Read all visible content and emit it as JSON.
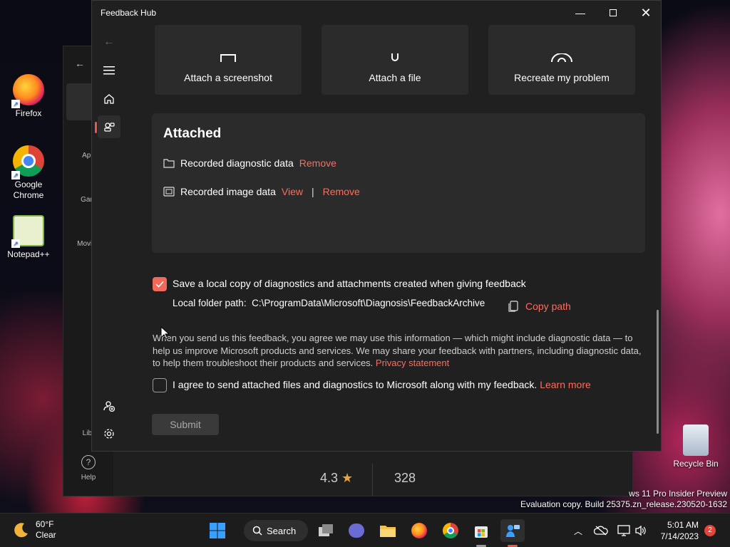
{
  "desktop": {
    "icons": [
      {
        "label": "Firefox"
      },
      {
        "label": "Google Chrome"
      },
      {
        "label": "Notepad++"
      },
      {
        "label": "Recycle Bin"
      }
    ],
    "watermark_line1": "ws 11 Pro Insider Preview",
    "watermark_line2": "Evaluation copy. Build 25375.zn_release.230520-1632"
  },
  "store_window": {
    "side_items": [
      "App",
      "Gam",
      "Movies",
      "Libr",
      "Help"
    ],
    "rating": "4.3",
    "rating_count": "328"
  },
  "feedback_hub": {
    "title": "Feedback Hub",
    "attach_buttons": [
      "Attach a screenshot",
      "Attach a file",
      "Recreate my problem"
    ],
    "attached_heading": "Attached",
    "attachments": [
      {
        "label": "Recorded diagnostic data",
        "actions": [
          "Remove"
        ]
      },
      {
        "label": "Recorded image data",
        "actions": [
          "View",
          "Remove"
        ]
      }
    ],
    "save_local_copy": {
      "checked": true,
      "label": "Save a local copy of diagnostics and attachments created when giving feedback",
      "path_label": "Local folder path:",
      "path_value": "C:\\ProgramData\\Microsoft\\Diagnosis\\FeedbackArchive",
      "copy_button": "Copy path"
    },
    "disclaimer": "When you send us this feedback, you agree we may use this information — which might include diagnostic data — to help us improve Microsoft products and services. We may share your feedback with partners, including diagnostic data, to help them troubleshoot their products and services.",
    "privacy_link": "Privacy statement",
    "agree": {
      "checked": false,
      "label": "I agree to send attached files and diagnostics to Microsoft along with my feedback.",
      "link": "Learn more"
    },
    "submit_label": "Submit"
  },
  "taskbar": {
    "weather_temp": "60°F",
    "weather_desc": "Clear",
    "search_label": "Search",
    "time": "5:01 AM",
    "date": "7/14/2023",
    "notification_count": "2"
  },
  "colors": {
    "accent": "#ef6a5a",
    "link": "#ff6b5c",
    "window_bg": "#202020",
    "card_bg": "#2b2b2b"
  }
}
